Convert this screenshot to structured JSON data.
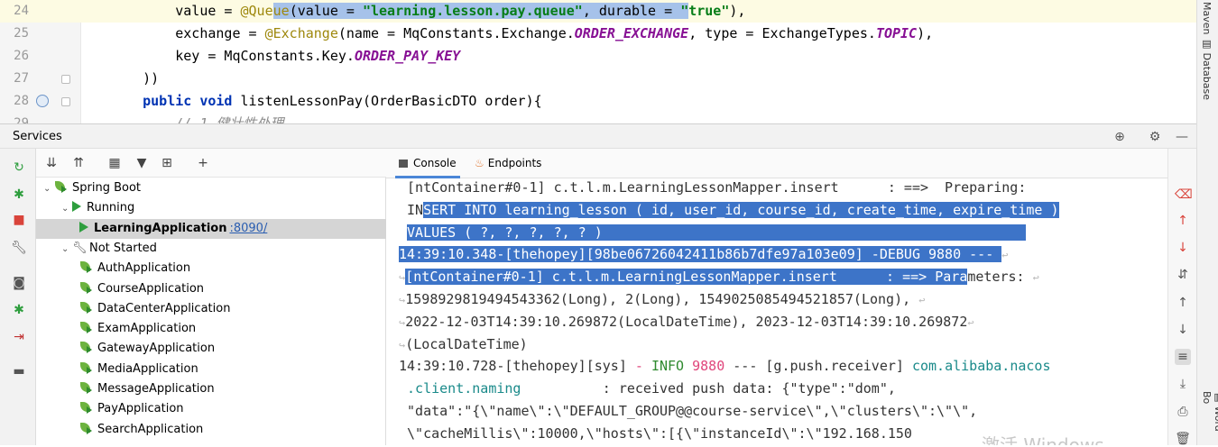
{
  "editor": {
    "lines": [
      {
        "num": "24",
        "segments": [
          {
            "t": "        value = ",
            "c": ""
          },
          {
            "t": "@Que",
            "c": "an"
          },
          {
            "t": "ue",
            "c": "an sel"
          },
          {
            "t": "(value = ",
            "c": "sel"
          },
          {
            "t": "\"learning.lesson.pay.queue\"",
            "c": "str sel"
          },
          {
            "t": ", durable = ",
            "c": "sel"
          },
          {
            "t": "\"",
            "c": "str sel"
          },
          {
            "t": "true\"",
            "c": "str"
          },
          {
            "t": "),",
            "c": ""
          }
        ]
      },
      {
        "num": "25",
        "segments": [
          {
            "t": "        exchange = ",
            "c": ""
          },
          {
            "t": "@Exchange",
            "c": "an"
          },
          {
            "t": "(name = MqConstants.Exchange.",
            "c": ""
          },
          {
            "t": "ORDER_EXCHANGE",
            "c": "it"
          },
          {
            "t": ", type = ExchangeTypes.",
            "c": ""
          },
          {
            "t": "TOPIC",
            "c": "it"
          },
          {
            "t": "),",
            "c": ""
          }
        ]
      },
      {
        "num": "26",
        "segments": [
          {
            "t": "        key = MqConstants.Key.",
            "c": ""
          },
          {
            "t": "ORDER_PAY_KEY",
            "c": "it"
          }
        ]
      },
      {
        "num": "27",
        "segments": [
          {
            "t": "    ))",
            "c": ""
          }
        ]
      },
      {
        "num": "28",
        "segments": [
          {
            "t": "    ",
            "c": ""
          },
          {
            "t": "public void",
            "c": "kw"
          },
          {
            "t": " listenLessonPay(OrderBasicDTO order){",
            "c": ""
          }
        ]
      },
      {
        "num": "29",
        "segments": [
          {
            "t": "        // 1.健壮性处理",
            "c": "cm"
          }
        ]
      }
    ]
  },
  "rightstrip": {
    "top_label": "Maven",
    "database_label": "Database",
    "word_label": "Word Bo"
  },
  "services": {
    "title": "Services",
    "tree": [
      {
        "label": "Spring Boot",
        "level": 0,
        "icon": "spring-icon",
        "expanded": true
      },
      {
        "label": "Running",
        "level": 1,
        "icon": "run-icon",
        "expanded": true
      },
      {
        "label": "LearningApplication",
        "port": ":8090/",
        "level": 2,
        "icon": "run-icon",
        "selected": true
      },
      {
        "label": "Not Started",
        "level": 1,
        "icon": "wrench-icon",
        "expanded": true
      },
      {
        "label": "AuthApplication",
        "level": 2,
        "icon": "spring-icon"
      },
      {
        "label": "CourseApplication",
        "level": 2,
        "icon": "spring-icon"
      },
      {
        "label": "DataCenterApplication",
        "level": 2,
        "icon": "spring-icon"
      },
      {
        "label": "ExamApplication",
        "level": 2,
        "icon": "spring-icon"
      },
      {
        "label": "GatewayApplication",
        "level": 2,
        "icon": "spring-icon"
      },
      {
        "label": "MediaApplication",
        "level": 2,
        "icon": "spring-icon"
      },
      {
        "label": "MessageApplication",
        "level": 2,
        "icon": "spring-icon"
      },
      {
        "label": "PayApplication",
        "level": 2,
        "icon": "spring-icon"
      },
      {
        "label": "SearchApplication",
        "level": 2,
        "icon": "spring-icon"
      }
    ]
  },
  "console": {
    "tabs": [
      {
        "label": "Console",
        "active": true
      },
      {
        "label": "Endpoints",
        "active": false
      }
    ],
    "lines": [
      {
        "indent": " ",
        "segments": [
          {
            "t": "[ntContainer#0-1] c.t.l.m.LearningLessonMapper.insert      : ==>  Preparing:",
            "c": ""
          }
        ]
      },
      {
        "indent": " ",
        "segments": [
          {
            "t": "IN",
            "c": ""
          },
          {
            "t": "SERT INTO learning_lesson ( id, user_id, course_id, create_time, expire_time )",
            "c": "csel"
          }
        ]
      },
      {
        "indent": " ",
        "segments": [
          {
            "t": "VALUES ( ?, ?, ?, ?, ? )                                                    ",
            "c": "csel"
          }
        ]
      },
      {
        "indent": "",
        "segments": [
          {
            "t": "14:39:10.348-[thehopey][98be06726042411b86b7dfe97a103e09] -DEBUG 9880 --- ",
            "c": "csel"
          },
          {
            "t": "↩",
            "c": "dim"
          }
        ]
      },
      {
        "indent": "",
        "segments": [
          {
            "t": "↪",
            "c": "dim"
          },
          {
            "t": "[ntContainer#0-1] c.t.l.m.LearningLessonMapper.insert      : ==> Para",
            "c": "csel"
          },
          {
            "t": "meters: ",
            "c": ""
          },
          {
            "t": "↩",
            "c": "dim"
          }
        ]
      },
      {
        "indent": "",
        "segments": [
          {
            "t": "↪",
            "c": "dim"
          },
          {
            "t": "1598929819494543362(Long), 2(Long), 1549025085494521857(Long), ",
            "c": ""
          },
          {
            "t": "↩",
            "c": "dim"
          }
        ]
      },
      {
        "indent": "",
        "segments": [
          {
            "t": "↪",
            "c": "dim"
          },
          {
            "t": "2022-12-03T14:39:10.269872(LocalDateTime), 2023-12-03T14:39:10.269872",
            "c": ""
          },
          {
            "t": "↩",
            "c": "dim"
          }
        ]
      },
      {
        "indent": "",
        "segments": [
          {
            "t": "↪",
            "c": "dim"
          },
          {
            "t": "(LocalDateTime)",
            "c": ""
          }
        ]
      },
      {
        "indent": "",
        "segments": [
          {
            "t": "14:39:10.728-[thehopey][sys] ",
            "c": ""
          },
          {
            "t": "- ",
            "c": "pink"
          },
          {
            "t": "INFO",
            "c": "info"
          },
          {
            "t": " ",
            "c": ""
          },
          {
            "t": "9880",
            "c": "pink"
          },
          {
            "t": " --- [g.push.receiver] ",
            "c": ""
          },
          {
            "t": "com.alibaba.nacos",
            "c": "green"
          }
        ]
      },
      {
        "indent": " ",
        "segments": [
          {
            "t": ".client.naming",
            "c": "green"
          },
          {
            "t": "          : received push data: {\"type\":\"dom\",",
            "c": ""
          }
        ]
      },
      {
        "indent": " ",
        "segments": [
          {
            "t": "\"data\":\"{\\\"name\\\":\\\"DEFAULT_GROUP@@course-service\\\",\\\"clusters\\\":\\\"\\\",",
            "c": ""
          }
        ]
      },
      {
        "indent": " ",
        "segments": [
          {
            "t": "\\\"cacheMillis\\\":10000,\\\"hosts\\\":[{\\\"instanceId\\\":\\\"192.168.150",
            "c": ""
          }
        ]
      }
    ],
    "watermark": "激活 Windows"
  },
  "colors": {
    "selection": "#3d74c8",
    "accent": "#4a86d7",
    "spring_green": "#6db33f",
    "stop_red": "#d9443b"
  }
}
